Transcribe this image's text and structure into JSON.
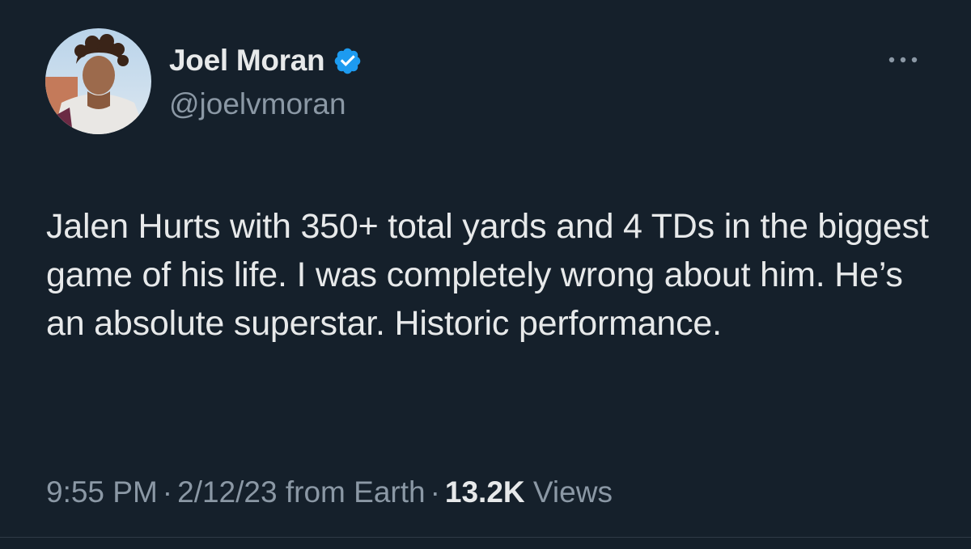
{
  "author": {
    "display_name": "Joel Moran",
    "handle": "@joelvmoran",
    "verified": true
  },
  "tweet": {
    "text": "Jalen Hurts with 350+ total yards and 4 TDs in the biggest game of his life. I was completely wrong about him. He’s an absolute superstar. Historic performance."
  },
  "meta": {
    "time": "9:55 PM",
    "separator": "·",
    "date": "2/12/23",
    "source": "from Earth",
    "views_count": "13.2K",
    "views_label": "Views"
  },
  "colors": {
    "background": "#15202b",
    "primary_text": "#e7e9ea",
    "secondary_text": "#8b98a5",
    "verified_badge": "#1d9bf0"
  },
  "icons": {
    "verified": "verified-badge-icon",
    "more": "more-options-icon"
  }
}
